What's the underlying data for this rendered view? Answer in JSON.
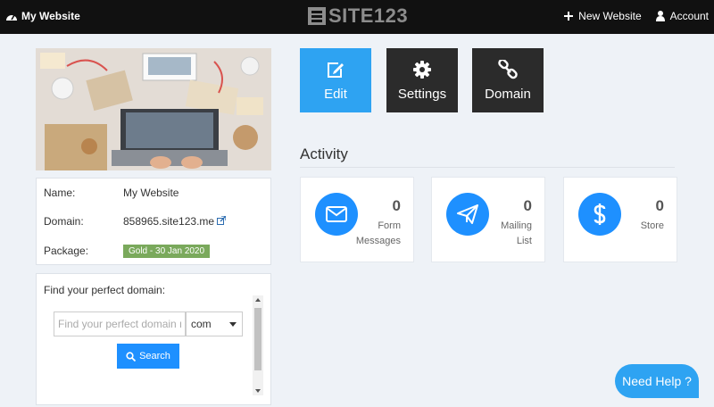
{
  "topbar": {
    "site_name": "My Website",
    "logo_text": "SITE123",
    "new_website": "New Website",
    "account": "Account"
  },
  "actions": {
    "edit": "Edit",
    "settings": "Settings",
    "domain": "Domain"
  },
  "info": {
    "name_label": "Name:",
    "name_value": "My Website",
    "domain_label": "Domain:",
    "domain_value": "858965.site123.me",
    "package_label": "Package:",
    "package_value": "Gold - 30 Jan 2020"
  },
  "domain_search": {
    "title": "Find your perfect domain:",
    "placeholder": "Find your perfect domain name",
    "tld": "com",
    "button": "Search"
  },
  "activity": {
    "title": "Activity",
    "cards": [
      {
        "count": "0",
        "line1": "Form",
        "line2": "Messages",
        "icon": "envelope-icon"
      },
      {
        "count": "0",
        "line1": "Mailing",
        "line2": "List",
        "icon": "paper-plane-icon"
      },
      {
        "count": "0",
        "line1": "Store",
        "line2": "",
        "icon": "dollar-icon"
      }
    ]
  },
  "help": {
    "label": "Need Help ?"
  },
  "colors": {
    "accent": "#2ea3f2",
    "dark_button": "#2b2b2b",
    "topbar": "#111111",
    "badge": "#7aa95c"
  }
}
